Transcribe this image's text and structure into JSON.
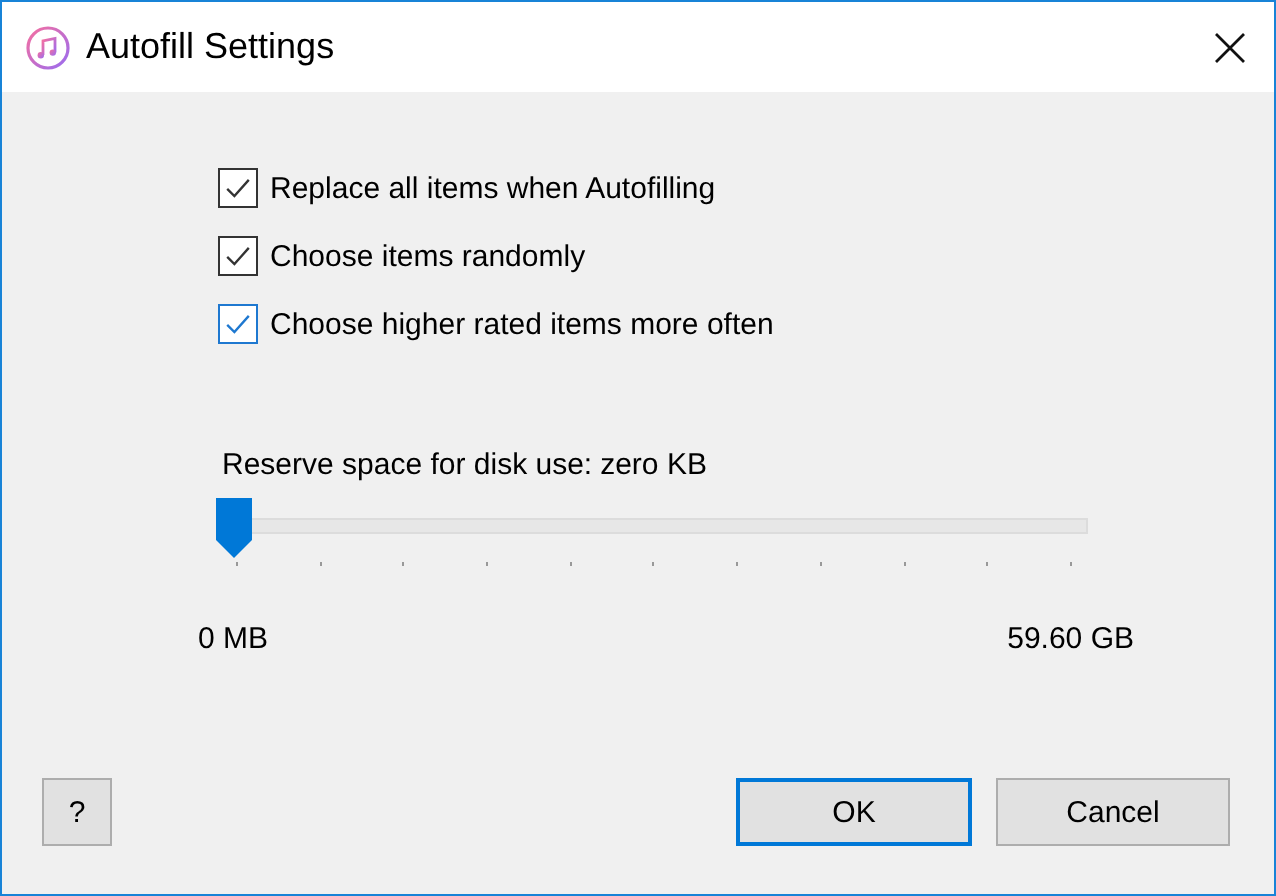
{
  "window": {
    "title": "Autofill Settings"
  },
  "options": [
    {
      "label": "Replace all items when Autofilling",
      "checked": true,
      "focused": false
    },
    {
      "label": "Choose items randomly",
      "checked": true,
      "focused": false
    },
    {
      "label": "Choose higher rated items more often",
      "checked": true,
      "focused": true
    }
  ],
  "reserve": {
    "label": "Reserve space for disk use:",
    "value": "zero KB",
    "level": 0,
    "min_label": "0 MB",
    "max_label": "59.60 GB"
  },
  "buttons": [
    {
      "label": "?",
      "default": false
    },
    {
      "label": "OK",
      "default": true
    },
    {
      "label": "Cancel",
      "default": false
    }
  ]
}
